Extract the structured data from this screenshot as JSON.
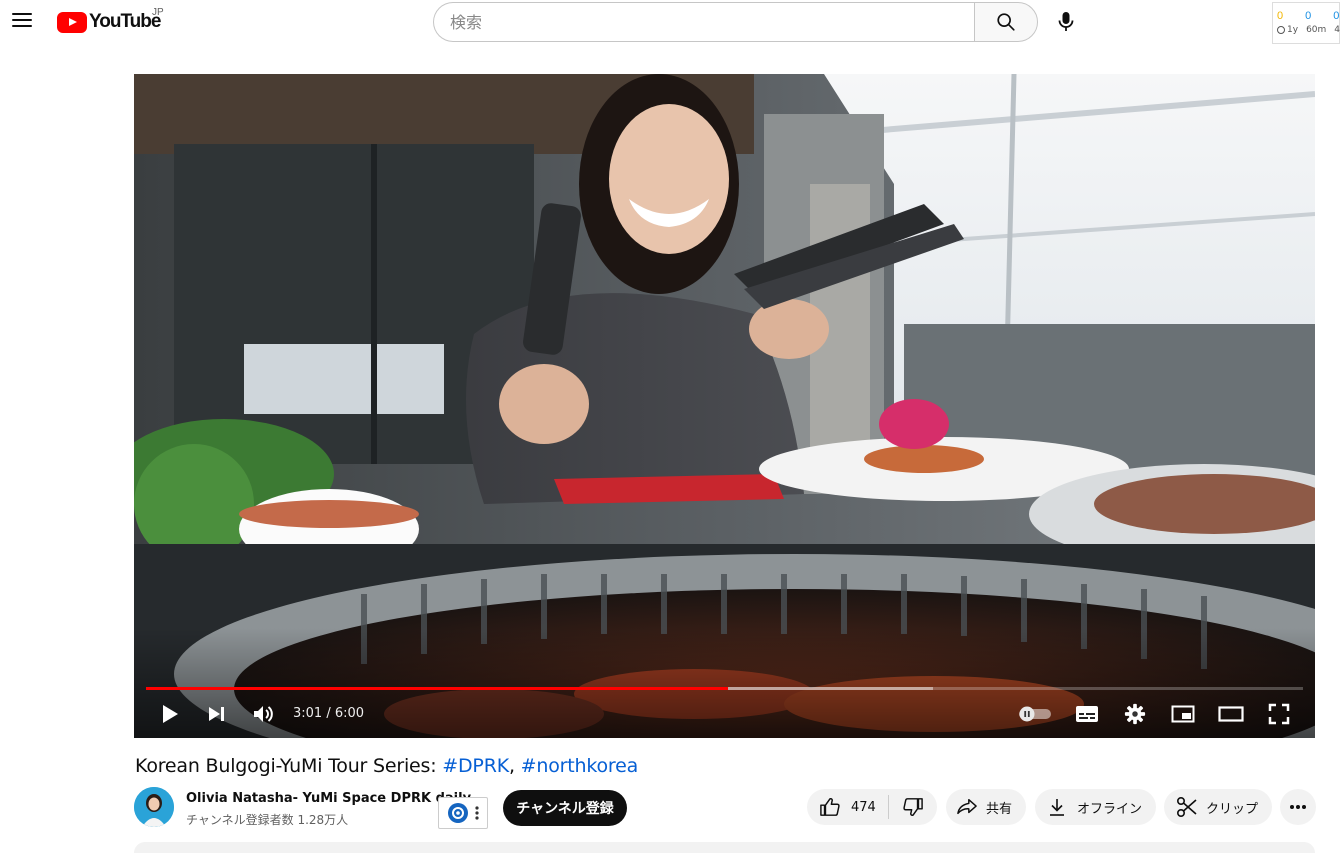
{
  "header": {
    "logo_text": "YouTube",
    "region": "JP",
    "search_placeholder": "検索",
    "extension": {
      "counts": [
        "0",
        "0",
        "0"
      ],
      "periods": [
        "1y",
        "60m",
        "4"
      ]
    }
  },
  "player": {
    "time": "3:01 / 6:00",
    "progress": 0.5028,
    "buffered": 0.68
  },
  "video": {
    "title_text": "Korean Bulgogi-YuMi Tour Series: ",
    "hashtag1": "#DPRK",
    "separator": ", ",
    "hashtag2": "#northkorea"
  },
  "channel": {
    "name": "Olivia Natasha- YuMi Space DPRK daily",
    "subscribers": "チャンネル登録者数 1.28万人",
    "subscribe_label": "チャンネル登録"
  },
  "actions": {
    "like_count": "474",
    "share_label": "共有",
    "offline_label": "オフライン",
    "clip_label": "クリップ"
  },
  "colors": {
    "brand_red": "#ff0000",
    "link_blue": "#065fd4",
    "ext_yellow": "#f2b600",
    "ext_blue": "#1a8fe3"
  }
}
